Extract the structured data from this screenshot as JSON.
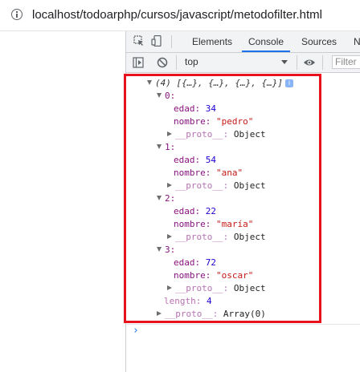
{
  "address_bar": {
    "url": "localhost/todoarphp/cursos/javascript/metodofilter.html"
  },
  "devtools": {
    "tabs": [
      {
        "label": "Elements",
        "active": false
      },
      {
        "label": "Console",
        "active": true
      },
      {
        "label": "Sources",
        "active": false
      },
      {
        "label": "N",
        "active": false
      }
    ],
    "toolbar": {
      "context": "top",
      "filter_placeholder": "Filter"
    },
    "console": {
      "array_summary": "(4) [{…}, {…}, {…}, {…}]",
      "info_badge": "i",
      "items": [
        {
          "index": "0:",
          "edad": "34",
          "nombre": "\"pedro\""
        },
        {
          "index": "1:",
          "edad": "54",
          "nombre": "\"ana\""
        },
        {
          "index": "2:",
          "edad": "22",
          "nombre": "\"maría\""
        },
        {
          "index": "3:",
          "edad": "72",
          "nombre": "\"oscar\""
        }
      ],
      "edad_key": "edad:",
      "nombre_key": "nombre:",
      "proto_key": "__proto__:",
      "proto_object": "Object",
      "length_key": "length:",
      "length_value": "4",
      "array_proto_value": "Array(0)",
      "prompt": "›"
    }
  },
  "colors": {
    "highlight_box": "#e8121f",
    "active_tab_indicator": "#1a73e8",
    "key_purple": "#881280",
    "string_red": "#c41a16",
    "number_blue": "#1c00cf"
  }
}
